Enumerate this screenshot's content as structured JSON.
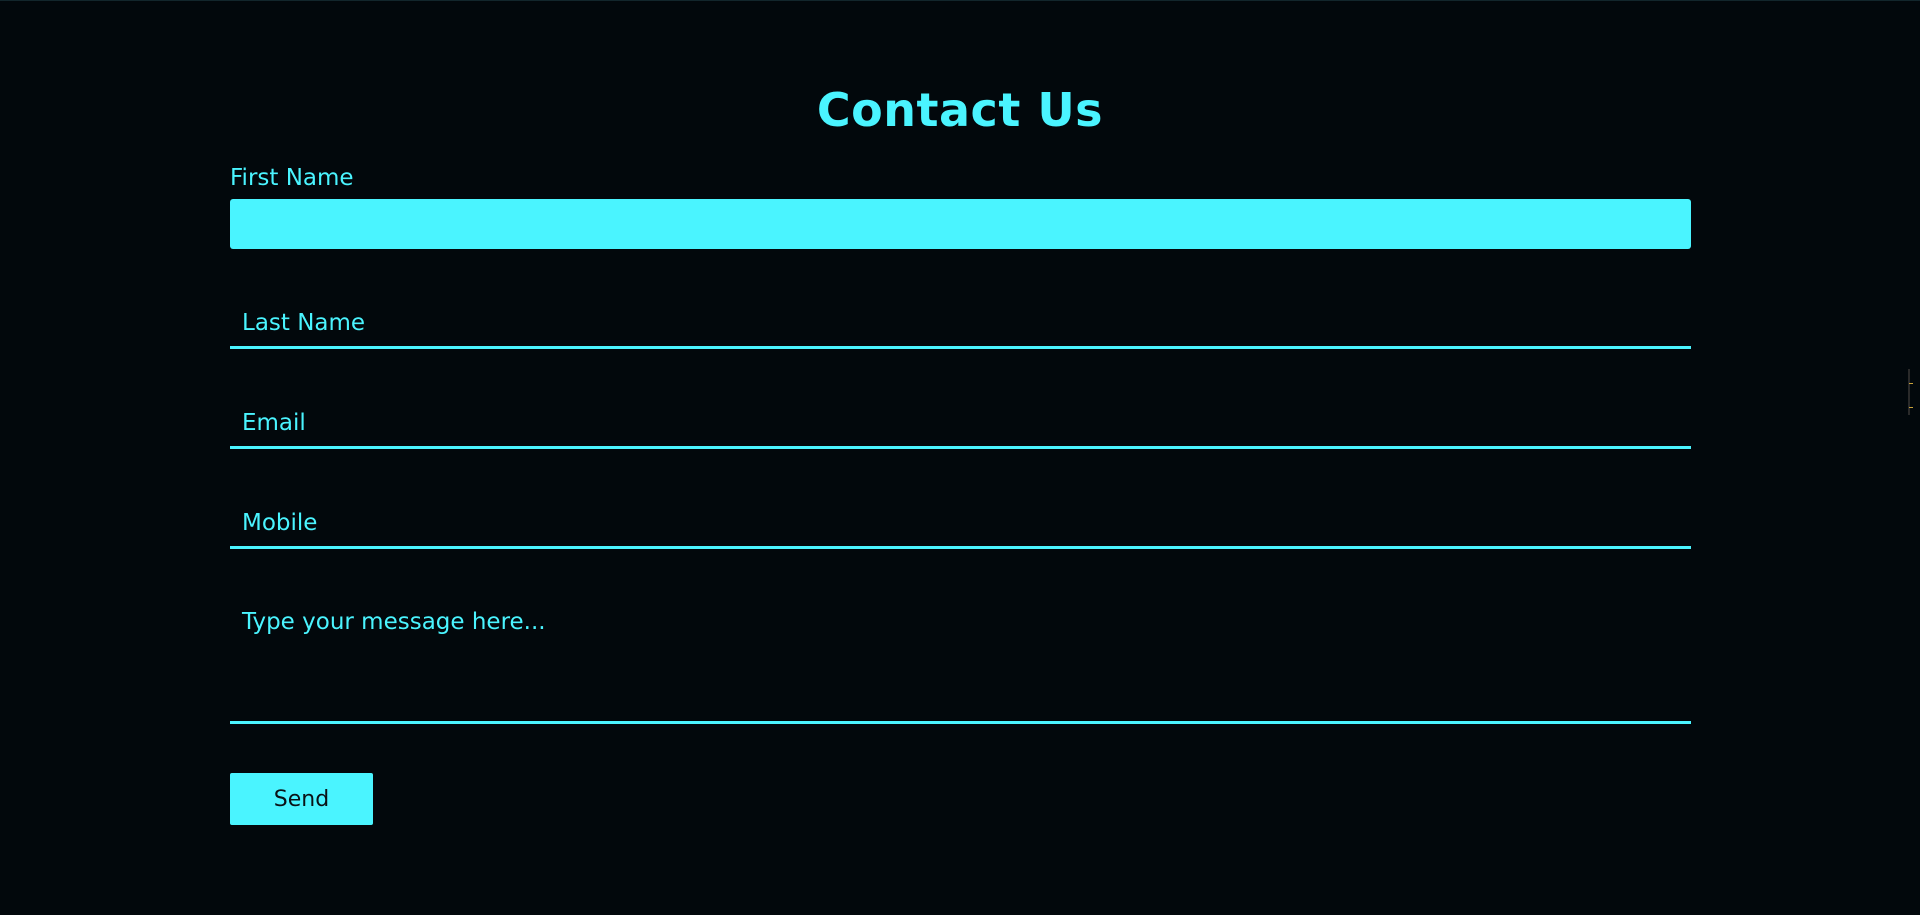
{
  "page": {
    "title": "Contact Us"
  },
  "form": {
    "first_name": {
      "label": "First Name",
      "value": ""
    },
    "last_name": {
      "placeholder": "Last Name",
      "value": ""
    },
    "email": {
      "placeholder": "Email",
      "value": ""
    },
    "mobile": {
      "placeholder": "Mobile",
      "value": ""
    },
    "message": {
      "placeholder": "Type your message here...",
      "value": ""
    },
    "send_label": "Send"
  },
  "colors": {
    "background": "#02080c",
    "accent": "#4af4ff",
    "button_text": "#0a1216"
  }
}
